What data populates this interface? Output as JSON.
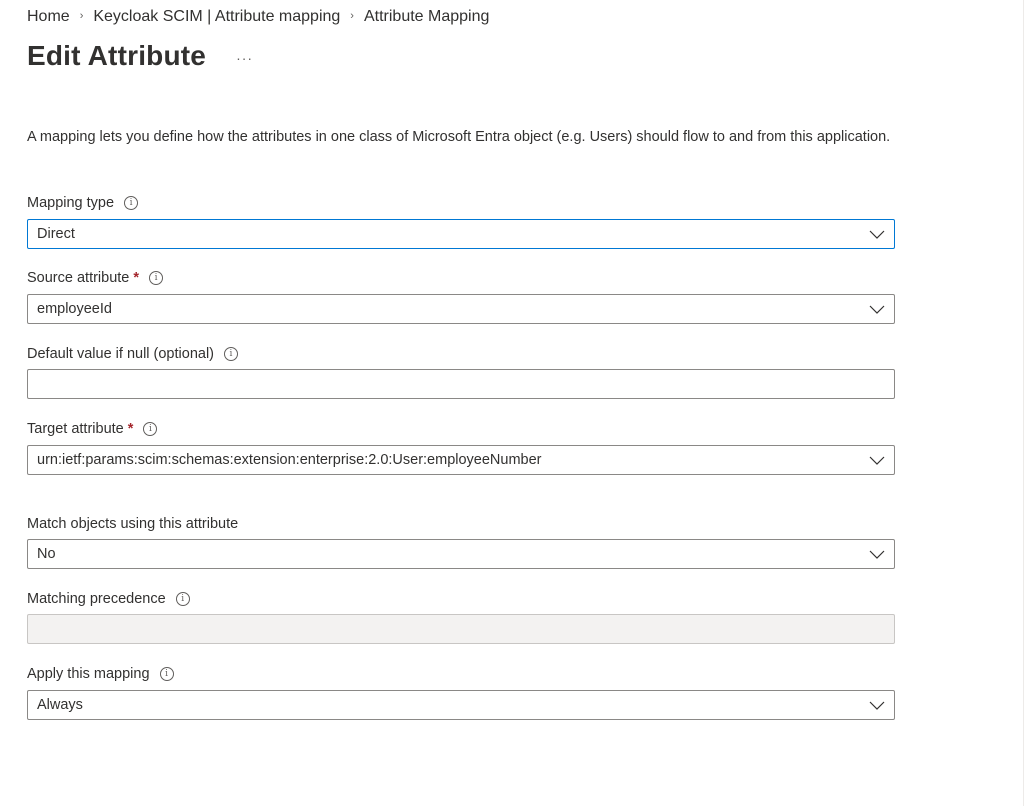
{
  "breadcrumb": {
    "items": [
      "Home",
      "Keycloak SCIM | Attribute mapping",
      "Attribute Mapping"
    ],
    "separator": "›"
  },
  "header": {
    "title": "Edit Attribute",
    "more_label": "···"
  },
  "description": "A mapping lets you define how the attributes in one class of Microsoft Entra object (e.g. Users) should flow to and from this application.",
  "form": {
    "mapping_type": {
      "label": "Mapping type",
      "value": "Direct"
    },
    "source_attribute": {
      "label": "Source attribute",
      "required_mark": "*",
      "value": "employeeId"
    },
    "default_value": {
      "label": "Default value if null (optional)",
      "value": ""
    },
    "target_attribute": {
      "label": "Target attribute",
      "required_mark": "*",
      "value": "urn:ietf:params:scim:schemas:extension:enterprise:2.0:User:employeeNumber"
    },
    "match_objects": {
      "label": "Match objects using this attribute",
      "value": "No"
    },
    "matching_precedence": {
      "label": "Matching precedence",
      "value": ""
    },
    "apply_mapping": {
      "label": "Apply this mapping",
      "value": "Always"
    }
  },
  "icons": {
    "info": "info-icon",
    "chevron": "chevron-down-icon",
    "more": "more-icon"
  },
  "colors": {
    "text": "#323130",
    "focus_border": "#0078d4",
    "required": "#a4262c",
    "disabled_bg": "#f3f2f1"
  }
}
